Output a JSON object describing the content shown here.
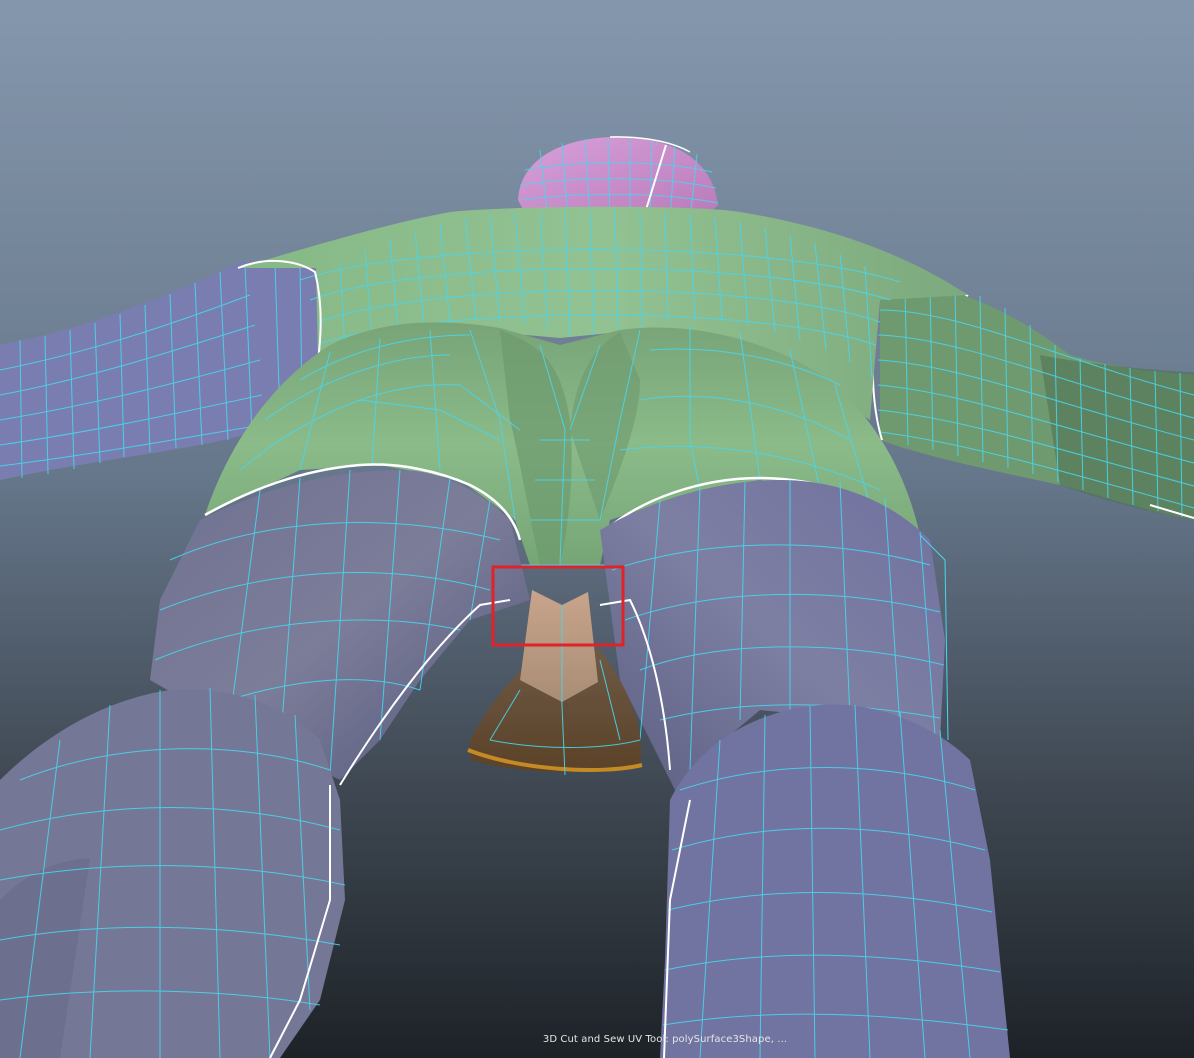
{
  "viewport": {
    "tool_status": "3D Cut and Sew UV Tool: polySurface3Shape, ...",
    "colors": {
      "background_top": "#8496ab",
      "background_bottom": "#1f2429",
      "wireframe": "#49d6ee",
      "uv_seam": "#ffffff",
      "selection_box": "#e0222a",
      "shell_torso": "#86b887",
      "shell_legs_arms": "#7a7d9e",
      "shell_head": "#cf8ed3",
      "shell_crotch": "#c29f86"
    }
  }
}
